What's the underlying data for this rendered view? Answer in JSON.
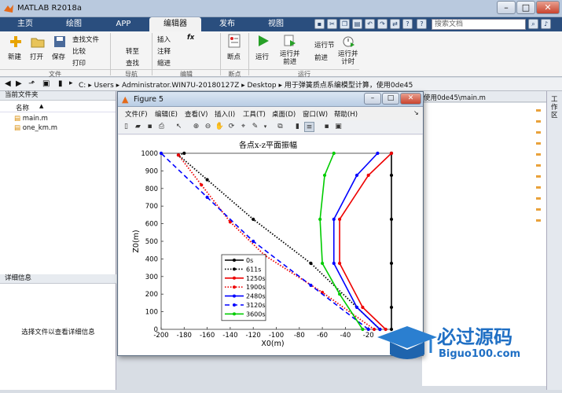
{
  "window": {
    "title": "MATLAB R2018a"
  },
  "tabs": [
    "主页",
    "绘图",
    "APP",
    "编辑器",
    "发布",
    "视图"
  ],
  "active_tab": "编辑器",
  "search": {
    "placeholder": "搜索文档"
  },
  "ribbon": {
    "file": {
      "new": "新建",
      "open": "打开",
      "save": "保存",
      "find_files": "查找文件",
      "compare": "比较",
      "print": "打印",
      "section": "文件"
    },
    "nav": {
      "goto": "转至",
      "find": "查找",
      "section": "导航"
    },
    "edit": {
      "insert": "插入",
      "fx": "fx",
      "comment": "注释",
      "indent": "缩进",
      "section": "编辑"
    },
    "breakpoints": {
      "label": "断点",
      "section": "断点"
    },
    "run": {
      "run": "运行",
      "run_advance": "运行并\n前进",
      "run_section": "运行节",
      "advance": "前进",
      "run_time": "运行并\n计时",
      "section": "运行"
    }
  },
  "address": {
    "segments": [
      "C:",
      "Users",
      "Administrator.WIN7U-20180127Z",
      "Desktop",
      "用于弹簧质点系编模型计算，使用0de45"
    ]
  },
  "left_panel": {
    "header": "当前文件夹",
    "column_name": "名称",
    "files": [
      "main.m",
      "one_km.m"
    ],
    "detail_header": "详细信息",
    "detail_text": "选择文件以查看详细信息"
  },
  "editor": {
    "tab_text": "使用0de45\\main.m"
  },
  "workspace_tab": "工作区",
  "figure": {
    "title": "Figure 5",
    "menu": [
      "文件(F)",
      "编辑(E)",
      "查看(V)",
      "插入(I)",
      "工具(T)",
      "桌面(D)",
      "窗口(W)",
      "帮助(H)"
    ]
  },
  "chart_data": {
    "type": "line",
    "title": "各点x-z平面振幅",
    "xlabel": "X0(m)",
    "ylabel": "Z0(m)",
    "xlim": [
      -200,
      0
    ],
    "ylim": [
      0,
      1000
    ],
    "xticks": [
      -200,
      -180,
      -160,
      -140,
      -120,
      -100,
      -80,
      -60,
      -40,
      -20,
      0
    ],
    "yticks": [
      0,
      100,
      200,
      300,
      400,
      500,
      600,
      700,
      800,
      900,
      1000
    ],
    "grid": false,
    "legend_position": "lower-center",
    "series": [
      {
        "name": "0s",
        "color": "#000000",
        "dash": "solid",
        "x": [
          0,
          0,
          0,
          0,
          0,
          0,
          0
        ],
        "y": [
          0,
          125,
          375,
          625,
          875,
          1000,
          1000
        ]
      },
      {
        "name": "611s",
        "color": "#000000",
        "dash": "dotted",
        "x": [
          -10,
          -70,
          -120,
          -160,
          -185,
          -180
        ],
        "y": [
          0,
          375,
          625,
          850,
          990,
          1000
        ]
      },
      {
        "name": "1250s",
        "color": "#ee0000",
        "dash": "solid",
        "x": [
          -5,
          -25,
          -45,
          -45,
          -20,
          0
        ],
        "y": [
          0,
          125,
          375,
          625,
          875,
          1000
        ]
      },
      {
        "name": "1900s",
        "color": "#ee0000",
        "dash": "dotted",
        "x": [
          -15,
          -60,
          -110,
          -140,
          -165,
          -185
        ],
        "y": [
          0,
          210,
          420,
          610,
          820,
          990
        ]
      },
      {
        "name": "2480s",
        "color": "#0000ff",
        "dash": "solid",
        "x": [
          -10,
          -30,
          -50,
          -50,
          -30,
          -12
        ],
        "y": [
          0,
          125,
          375,
          625,
          875,
          1000
        ]
      },
      {
        "name": "3120s",
        "color": "#0000ff",
        "dash": "dashed",
        "x": [
          -20,
          -70,
          -120,
          -160,
          -200
        ],
        "y": [
          0,
          250,
          500,
          750,
          1000
        ]
      },
      {
        "name": "3600s",
        "color": "#00cc00",
        "dash": "solid",
        "x": [
          -25,
          -45,
          -60,
          -62,
          -58,
          -50
        ],
        "y": [
          0,
          200,
          375,
          625,
          875,
          1000
        ]
      }
    ]
  },
  "watermark": {
    "main": "必过源码",
    "sub": "Biguo100.com"
  },
  "colors": {
    "ribbon_tab_bg": "#2a4e7e",
    "titlebar": "#b9c9de"
  }
}
